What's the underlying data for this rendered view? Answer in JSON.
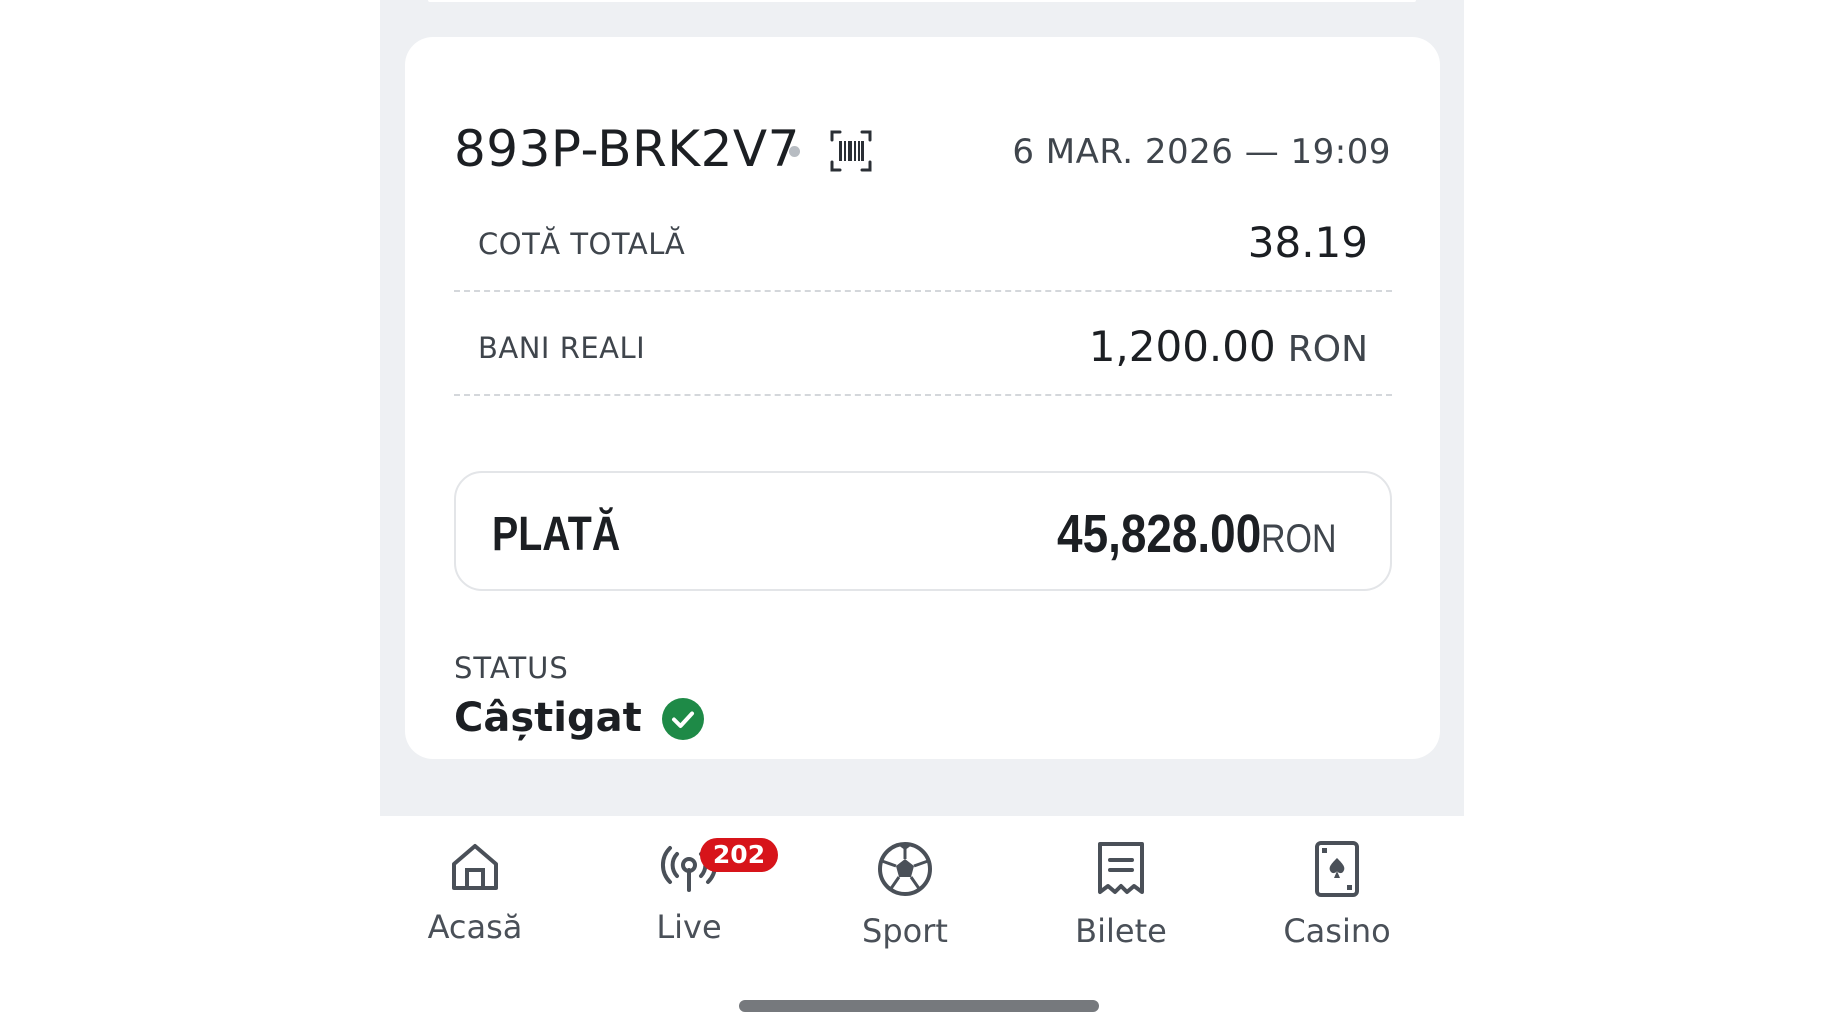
{
  "ticket": {
    "id": "893P-BRK2V7",
    "date": "6 MAR. 2026 — 19:09"
  },
  "rows": [
    {
      "label": "COTĂ TOTALĂ",
      "value": "38.19",
      "unit": ""
    },
    {
      "label": "BANI REALI",
      "value": "1,200.00",
      "unit": "RON"
    }
  ],
  "payout": {
    "label": "PLATĂ",
    "amount": "45,828.00",
    "unit": "RON"
  },
  "status": {
    "label": "STATUS",
    "value": "Câștigat",
    "color": "#1e8a47"
  },
  "nav": {
    "items": [
      {
        "label": "Acasă",
        "icon": "home-icon"
      },
      {
        "label": "Live",
        "icon": "live-broadcast-icon",
        "badge": "202"
      },
      {
        "label": "Sport",
        "icon": "soccer-ball-icon"
      },
      {
        "label": "Bilete",
        "icon": "ticket-receipt-icon"
      },
      {
        "label": "Casino",
        "icon": "playing-card-icon"
      }
    ]
  },
  "colors": {
    "badge": "#d7141a",
    "background": "#eef0f3",
    "icon": "#4a5058"
  }
}
